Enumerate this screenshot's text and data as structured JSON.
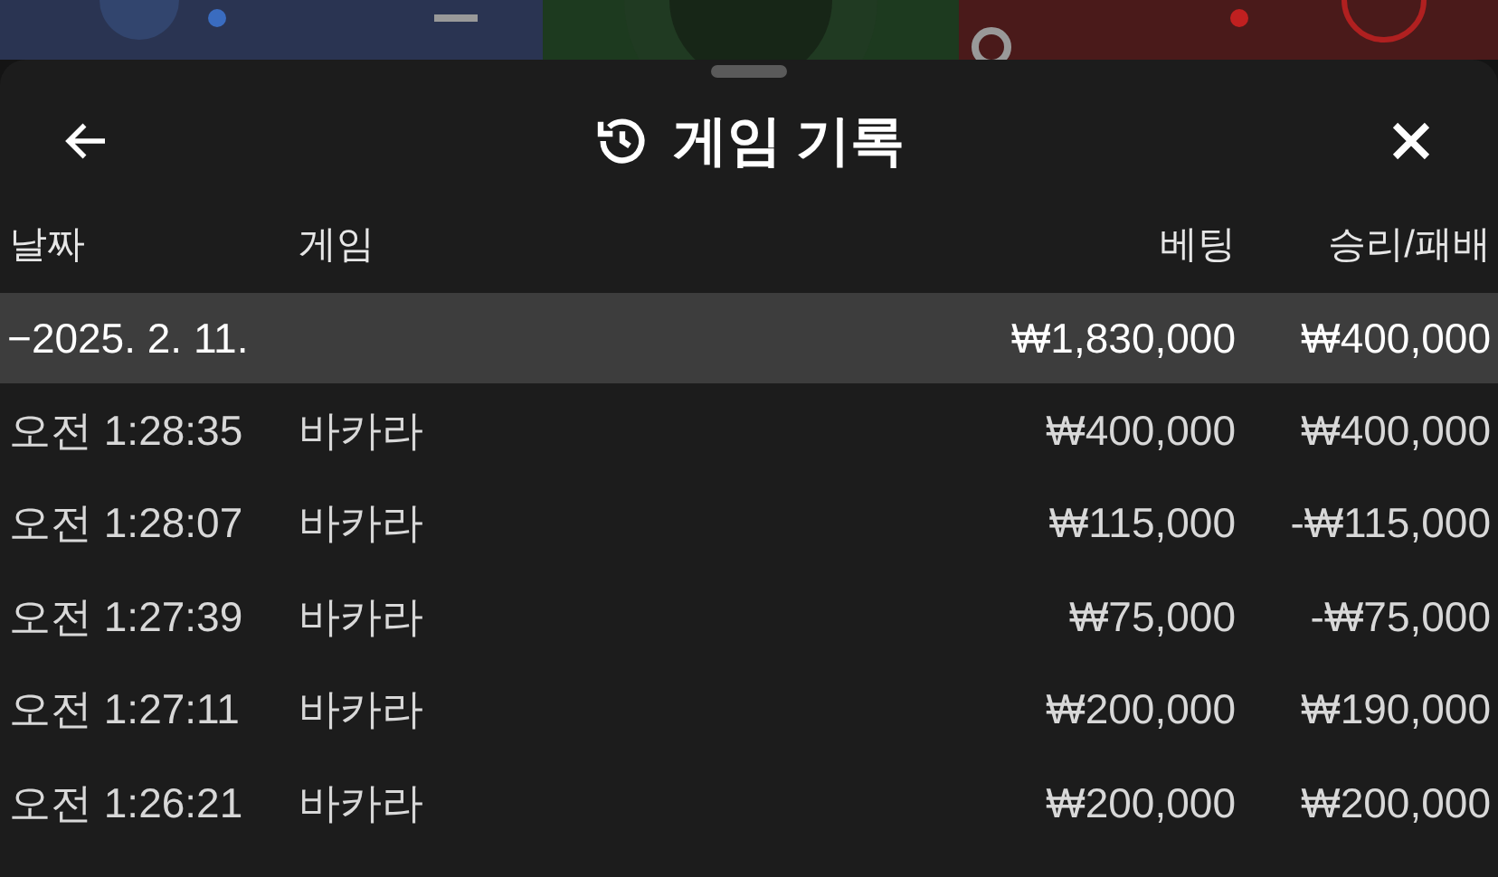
{
  "title": "게임 기록",
  "columns": [
    "날짜",
    "게임",
    "베팅",
    "승리/패배"
  ],
  "date_group": {
    "toggle": "−",
    "date": "2025. 2. 11.",
    "bet": "₩1,830,000",
    "result": "₩400,000"
  },
  "rows": [
    {
      "time": "오전 1:28:35",
      "game": "바카라",
      "bet": "₩400,000",
      "result": "₩400,000"
    },
    {
      "time": "오전 1:28:07",
      "game": "바카라",
      "bet": "₩115,000",
      "result": "-₩115,000"
    },
    {
      "time": "오전 1:27:39",
      "game": "바카라",
      "bet": "₩75,000",
      "result": "-₩75,000"
    },
    {
      "time": "오전 1:27:11",
      "game": "바카라",
      "bet": "₩200,000",
      "result": "₩190,000"
    },
    {
      "time": "오전 1:26:21",
      "game": "바카라",
      "bet": "₩200,000",
      "result": "₩200,000"
    }
  ]
}
